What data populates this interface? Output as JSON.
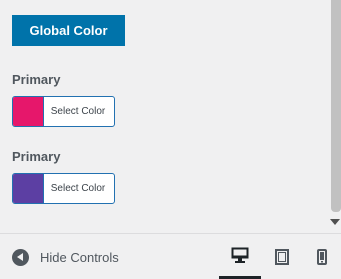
{
  "section_button": {
    "label": "Global Color"
  },
  "controls": [
    {
      "label": "Primary",
      "button_text": "Select Color",
      "color": "#e6176b"
    },
    {
      "label": "Primary",
      "button_text": "Select Color",
      "color": "#5c3fa3"
    }
  ],
  "footer": {
    "hide_controls_label": "Hide Controls",
    "hide_icon": "collapse-arrow-icon",
    "devices": [
      {
        "name": "desktop",
        "icon": "desktop-icon",
        "active": true
      },
      {
        "name": "tablet",
        "icon": "tablet-icon",
        "active": false
      },
      {
        "name": "mobile",
        "icon": "mobile-icon",
        "active": false
      }
    ]
  },
  "colors": {
    "accent": "#0073aa",
    "picker_border": "#2271b1",
    "background": "#f0f0f1"
  }
}
